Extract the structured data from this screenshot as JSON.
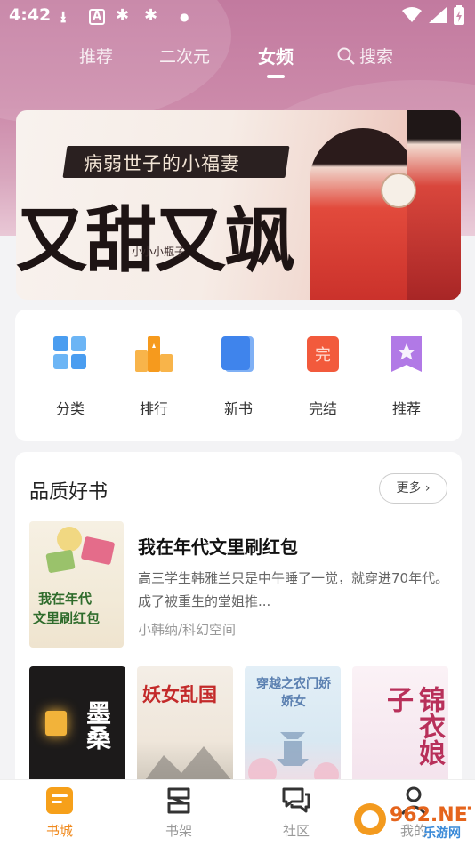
{
  "status_bar": {
    "time": "4:42",
    "icons": [
      "download-icon",
      "a-icon",
      "bug-icon",
      "bug-icon",
      "dot-icon",
      "wifi-icon",
      "signal-icon",
      "battery-icon"
    ]
  },
  "top_tabs": [
    {
      "label": "推荐",
      "active": false
    },
    {
      "label": "二次元",
      "active": false
    },
    {
      "label": "女频",
      "active": true
    },
    {
      "label": "搜索",
      "active": false,
      "icon": "search-icon"
    }
  ],
  "banner": {
    "subtitle": "病弱世子的小福妻",
    "title": "又甜又飒",
    "author": "小小小瓶子"
  },
  "quick_nav": [
    {
      "label": "分类",
      "icon": "grid-icon",
      "color": "#4a9df0"
    },
    {
      "label": "排行",
      "icon": "rank-icon",
      "color": "#f6a21d"
    },
    {
      "label": "新书",
      "icon": "book-icon",
      "color": "#4a8ef0"
    },
    {
      "label": "完结",
      "icon": "complete-icon",
      "badge": "完",
      "color": "#f25a3c"
    },
    {
      "label": "推荐",
      "icon": "star-icon",
      "color": "#b179e6"
    }
  ],
  "quality_section": {
    "title": "品质好书",
    "more_label": "更多",
    "featured": {
      "title": "我在年代文里刷红包",
      "description": "高三学生韩雅兰只是中午睡了一觉，就穿进70年代。成了被重生的堂姐推...",
      "meta": "小韩纳/科幻空间",
      "cover_line1": "我在年代",
      "cover_line2": "文里刷红包"
    },
    "covers": [
      {
        "text": "墨桑",
        "bg": "#1c1a1a",
        "color": "#ffffff"
      },
      {
        "text": "妖女乱国",
        "bg": "#f2ece4",
        "color": "#c32a2a"
      },
      {
        "text": "穿越之农门娇娇女",
        "bg": "#dbeaf3",
        "color": "#5a7fb0"
      },
      {
        "text": "锦衣娘子",
        "bg": "#f5e7f0",
        "color": "#b8305a"
      }
    ]
  },
  "bottom_nav": [
    {
      "label": "书城",
      "icon": "bookstore-icon",
      "active": true
    },
    {
      "label": "书架",
      "icon": "bookshelf-icon",
      "active": false
    },
    {
      "label": "社区",
      "icon": "community-icon",
      "active": false
    },
    {
      "label": "我的",
      "icon": "profile-icon",
      "active": false
    }
  ],
  "watermark": {
    "text1": "962.NET",
    "text2": "乐游网"
  }
}
